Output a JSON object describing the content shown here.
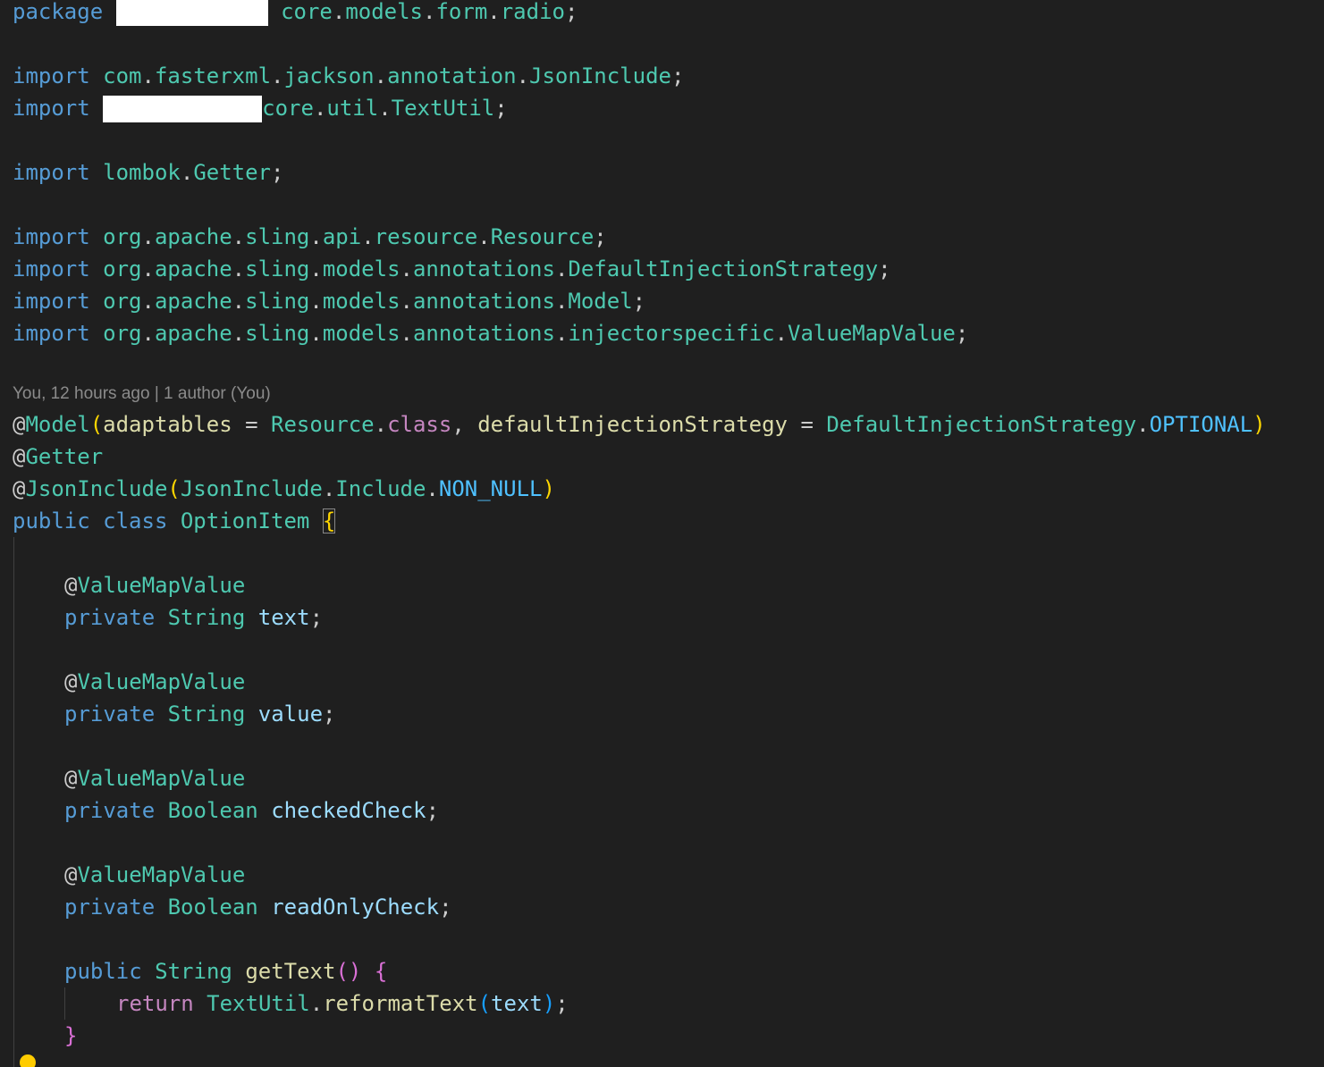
{
  "codelens": "You, 12 hours ago | 1 author (You)",
  "tokens": {
    "package": "package",
    "import": "import",
    "core": "core",
    "models": "models",
    "form": "form",
    "radio": "radio",
    "com": "com",
    "fasterxml": "fasterxml",
    "jackson": "jackson",
    "annotation": "annotation",
    "JsonInclude": "JsonInclude",
    "util": "util",
    "TextUtil": "TextUtil",
    "lombok": "lombok",
    "Getter": "Getter",
    "org": "org",
    "apache": "apache",
    "sling": "sling",
    "api": "api",
    "resource": "resource",
    "Resource": "Resource",
    "annotations": "annotations",
    "DefaultInjectionStrategy": "DefaultInjectionStrategy",
    "Model": "Model",
    "injectorspecific": "injectorspecific",
    "ValueMapValue": "ValueMapValue",
    "adaptables": "adaptables",
    "class": "class",
    "defaultInjectionStrategy": "defaultInjectionStrategy",
    "OPTIONAL": "OPTIONAL",
    "Include": "Include",
    "NON_NULL": "NON_NULL",
    "public": "public",
    "OptionItem": "OptionItem",
    "private": "private",
    "String": "String",
    "Boolean": "Boolean",
    "text": "text",
    "value": "value",
    "checkedCheck": "checkedCheck",
    "readOnlyCheck": "readOnlyCheck",
    "getText": "getText",
    "return": "return",
    "reformatText": "reformatText"
  }
}
